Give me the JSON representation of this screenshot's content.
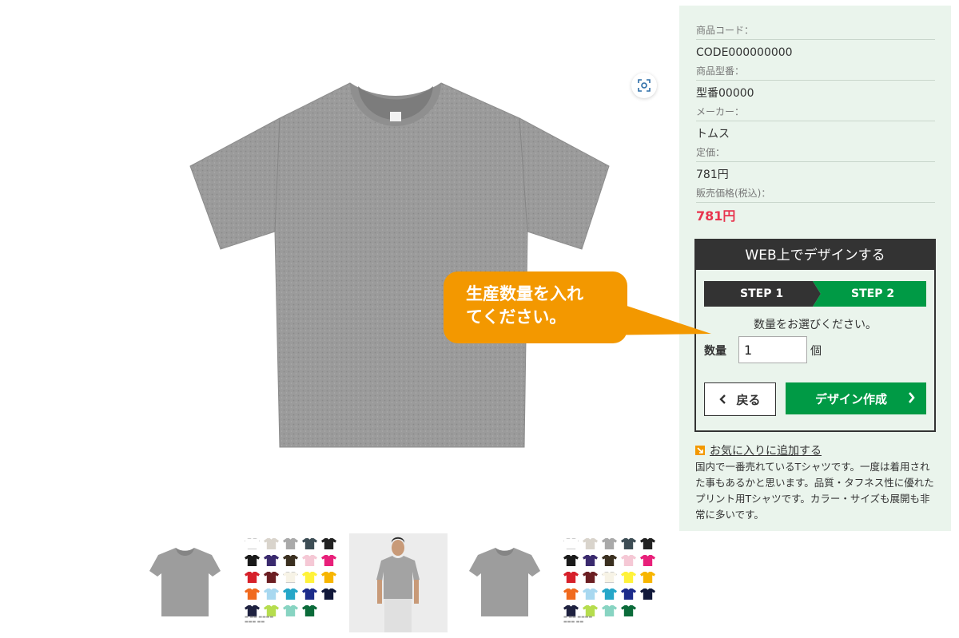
{
  "product": {
    "specs": [
      {
        "label": "商品コード：",
        "value": "CODE000000000"
      },
      {
        "label": "商品型番：",
        "value": "型番00000"
      },
      {
        "label": "メーカー：",
        "value": "トムス"
      },
      {
        "label": "定価：",
        "value": "781円"
      },
      {
        "label": "販売価格(税込)：",
        "value": "781円"
      }
    ],
    "favorite_label": "お気に入りに追加する",
    "description": "国内で一番売れているTシャツです。一度は着用された事もあるかと思います。品質・タフネス性に優れたプリント用Tシャツです。カラー・サイズも展開も非常に多いです。"
  },
  "design": {
    "title": "WEB上でデザインする",
    "step1": "STEP 1",
    "step2": "STEP 2",
    "instruction": "数量をお選びください。",
    "qty_label": "数量",
    "qty_value": "1",
    "qty_unit": "個",
    "back_label": "戻る",
    "create_label": "デザイン作成"
  },
  "callout": {
    "line1": "生産数量を入れ",
    "line2": "てください。"
  },
  "thumbnails": [
    {
      "kind": "gray-tshirt"
    },
    {
      "kind": "color-chart"
    },
    {
      "kind": "model-photo"
    },
    {
      "kind": "gray-tshirt"
    },
    {
      "kind": "color-chart"
    }
  ],
  "swatch_colors": [
    "#ffffff",
    "#d9d4cc",
    "#a9a9a9",
    "#3d4d55",
    "#222222",
    "#1a1a1a",
    "#3a2a6e",
    "#3b3020",
    "#f5c8d5",
    "#e8207a",
    "#d6202a",
    "#6b1e22",
    "#f7f3e6",
    "#fff23a",
    "#f7b500",
    "#f06a1e",
    "#a8d8f0",
    "#25a6c8",
    "#1c2b8a",
    "#11183a",
    "#1f2240",
    "#b6dd4e",
    "#88d4c2",
    "#0b6b3a"
  ],
  "icons": {
    "zoom": "zoom-icon",
    "favorite": "favorite-arrow-icon",
    "back": "chevron-left-icon",
    "create": "chevron-right-icon"
  },
  "colors": {
    "accent_green": "#009a45",
    "price_red": "#e8344e",
    "callout_orange": "#f39800",
    "panel_bg": "#eaf4ec"
  }
}
